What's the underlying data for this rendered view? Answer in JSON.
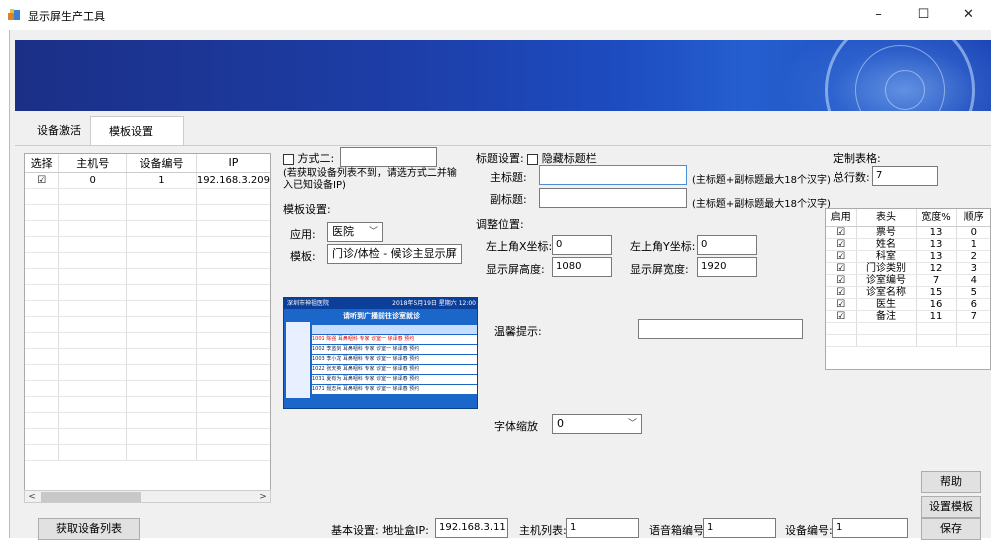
{
  "window": {
    "title": "显示屏生产工具",
    "minimize": "–",
    "maximize": "☐",
    "close": "✕"
  },
  "tabs": [
    {
      "label": "设备激活"
    },
    {
      "label": "模板设置"
    }
  ],
  "device_grid": {
    "headers": [
      "选择",
      "主机号",
      "设备编号",
      "IP"
    ],
    "rows": [
      {
        "checked": "☑",
        "host": "0",
        "device": "1",
        "ip": "192.168.3.209"
      }
    ]
  },
  "method2": {
    "label": "方式二:",
    "hint": "(若获取设备列表不到，请选方式二并输入已知设备IP)",
    "value": ""
  },
  "template": {
    "section_label": "模板设置:",
    "app_label": "应用:",
    "app_value": "医院",
    "template_label": "模板:",
    "template_value": "门诊/体检 - 候诊主显示屏"
  },
  "preview": {
    "hospital": "深圳市神祖医院",
    "datetime": "2018年5月19日 星期六 12:00",
    "heading": "请听到广播前往诊室就诊",
    "rows": [
      "1001  陈强  耳鼻咽科  专家  诊室一  徐泽春  预约",
      "1002  李蓝剑  耳鼻咽科  专家  诊室一  徐泽春  预约",
      "1003  李小龙  耳鼻咽科  专家  诊室一  徐泽春  预约",
      "1022  张天英  耳鼻咽科  专家  诊室一  徐泽春  预约",
      "1031  夏有为  耳鼻咽科  专家  诊室一  徐泽春  预约",
      "1071  聂志兵  耳鼻咽科  专家  诊室一  徐泽春  预约"
    ]
  },
  "title_settings": {
    "label": "标题设置:",
    "hide_label": "隐藏标题栏",
    "main_label": "主标题:",
    "main_value": "",
    "sub_label": "副标题:",
    "sub_value": "",
    "hint": "(主标题+副标题最大18个汉字)"
  },
  "position": {
    "label": "调整位置:",
    "x_label": "左上角X坐标:",
    "x_value": "0",
    "y_label": "左上角Y坐标:",
    "y_value": "0",
    "h_label": "显示屏高度:",
    "h_value": "1080",
    "w_label": "显示屏宽度:",
    "w_value": "1920"
  },
  "tip": {
    "label": "温馨提示:",
    "value": ""
  },
  "font_scale": {
    "label": "字体缩放",
    "value": "0"
  },
  "custom_table": {
    "label": "定制表格:",
    "rows_label": "总行数:",
    "rows_value": "7",
    "headers": [
      "启用",
      "表头",
      "宽度%",
      "顺序"
    ],
    "rows": [
      {
        "en": "☑",
        "name": "票号",
        "width": "13",
        "order": "0"
      },
      {
        "en": "☑",
        "name": "姓名",
        "width": "13",
        "order": "1"
      },
      {
        "en": "☑",
        "name": "科室",
        "width": "13",
        "order": "2"
      },
      {
        "en": "☑",
        "name": "门诊类别",
        "width": "12",
        "order": "3"
      },
      {
        "en": "☑",
        "name": "诊室编号",
        "width": "7",
        "order": "4"
      },
      {
        "en": "☑",
        "name": "诊室名称",
        "width": "15",
        "order": "5"
      },
      {
        "en": "☑",
        "name": "医生",
        "width": "16",
        "order": "6"
      },
      {
        "en": "☑",
        "name": "备注",
        "width": "11",
        "order": "7"
      }
    ]
  },
  "buttons": {
    "help": "帮助",
    "set_template": "设置模板",
    "save": "保存",
    "get_devices": "获取设备列表"
  },
  "basic": {
    "label": "基本设置: 地址盒IP:",
    "ip_value": "192.168.3.11",
    "host_label": "主机列表:",
    "host_value": "1",
    "audio_label": "语音箱编号:",
    "audio_value": "1",
    "device_label": "设备编号:",
    "device_value": "1"
  }
}
